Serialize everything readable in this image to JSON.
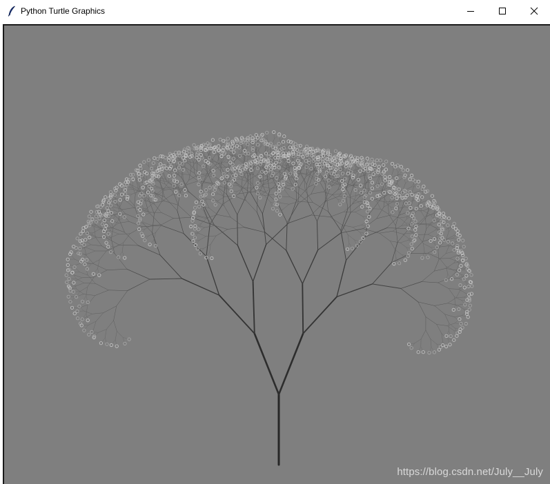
{
  "window": {
    "title": "Python Turtle Graphics",
    "app_icon": "feather-icon",
    "controls": {
      "minimize_icon": "minimize-icon",
      "maximize_icon": "maximize-icon",
      "close_icon": "close-icon"
    }
  },
  "canvas": {
    "background_color": "#7f7f7f",
    "drawing": "fractal-tree",
    "trunk_color": "#262626",
    "leaf_color": "#b5b5b5",
    "watermark": "https://blog.csdn.net/July__July"
  }
}
